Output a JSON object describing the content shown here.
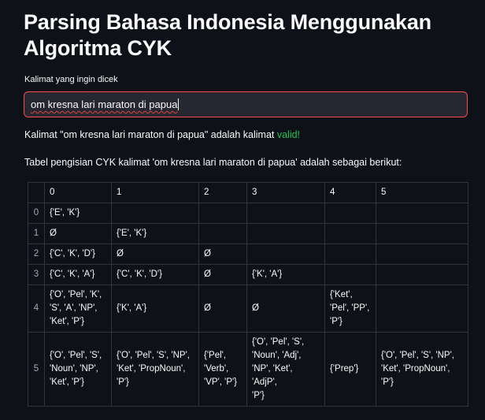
{
  "title": "Parsing Bahasa Indonesia Menggunakan Algoritma CYK",
  "input": {
    "label": "Kalimat yang ingin dicek",
    "value": "om kresna lari maraton di papua"
  },
  "result": {
    "prefix": "Kalimat \"om kresna lari maraton di papua\" adalah kalimat ",
    "status": "valid!",
    "status_color": "#21c354"
  },
  "table_intro": "Tabel pengisian CYK kalimat 'om kresna lari maraton di papua' adalah sebagai berikut:",
  "table": {
    "columns": [
      "0",
      "1",
      "2",
      "3",
      "4",
      "5"
    ],
    "rows": [
      {
        "index": "0",
        "cells": [
          "{'E', 'K'}",
          "",
          "",
          "",
          "",
          ""
        ]
      },
      {
        "index": "1",
        "cells": [
          "Ø",
          "{'E', 'K'}",
          "",
          "",
          "",
          ""
        ]
      },
      {
        "index": "2",
        "cells": [
          "{'C', 'K', 'D'}",
          "Ø",
          "Ø",
          "",
          "",
          ""
        ]
      },
      {
        "index": "3",
        "cells": [
          "{'C', 'K', 'A'}",
          "{'C', 'K', 'D'}",
          "Ø",
          "{'K', 'A'}",
          "",
          ""
        ]
      },
      {
        "index": "4",
        "cells": [
          "{'O', 'Pel', 'K',\n'S', 'A', 'NP',\n'Ket', 'P'}",
          "{'K', 'A'}",
          "Ø",
          "Ø",
          "{'Ket',\n'Pel', 'PP',\n'P'}",
          ""
        ]
      },
      {
        "index": "5",
        "cells": [
          "{'O', 'Pel', 'S',\n'Noun', 'NP',\n'Ket', 'P'}",
          "{'O', 'Pel', 'S', 'NP',\n'Ket', 'PropNoun',\n'P'}",
          "{'Pel',\n'Verb',\n'VP', 'P'}",
          "{'O', 'Pel', 'S',\n'Noun', 'Adj',\n'NP', 'Ket', 'AdjP',\n'P'}",
          "{'Prep'}",
          "{'O', 'Pel', 'S', 'NP',\n'Ket', 'PropNoun',\n'P'}"
        ]
      }
    ]
  }
}
